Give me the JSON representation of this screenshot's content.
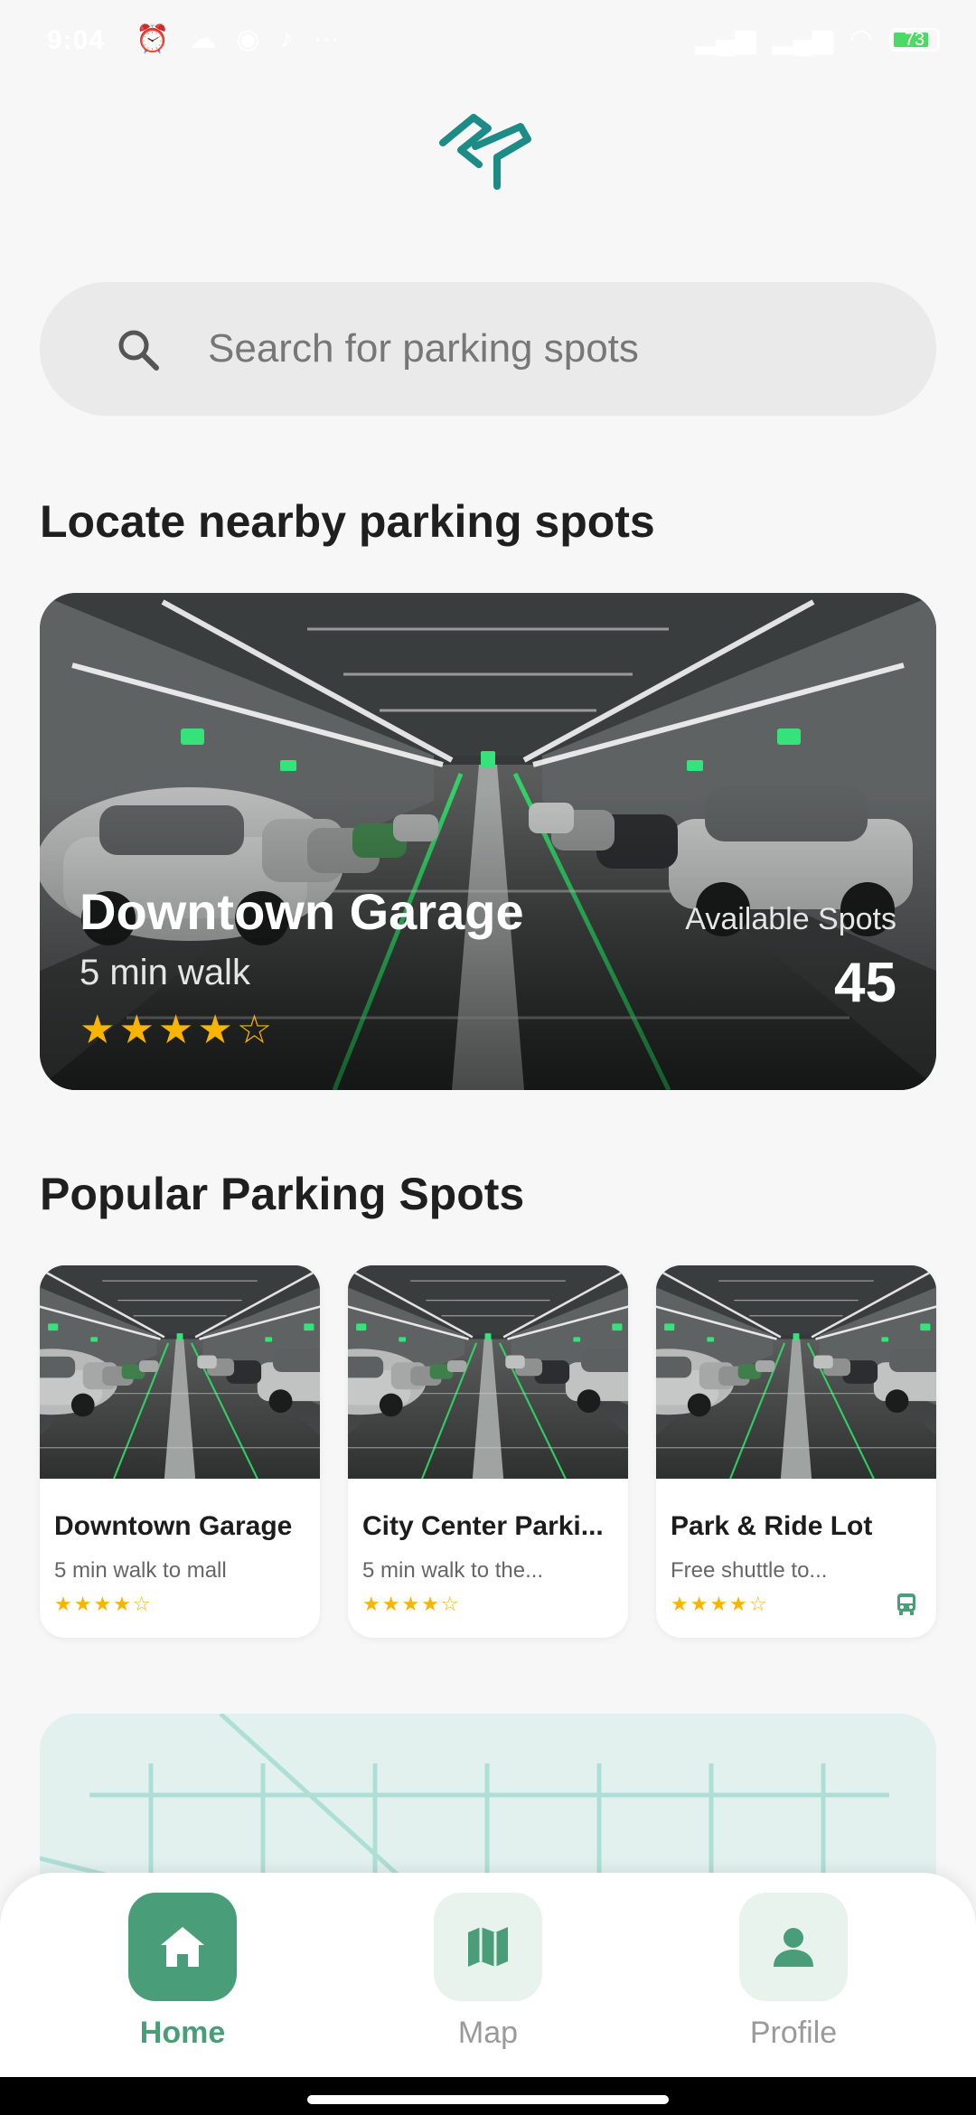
{
  "status_bar": {
    "time": "9:04",
    "battery": "73"
  },
  "search": {
    "placeholder": "Search for parking spots"
  },
  "nearby": {
    "title": "Locate nearby parking spots",
    "featured": {
      "name": "Downtown Garage",
      "walk": "5 min walk",
      "rating": 4,
      "rating_text": "★★★★☆",
      "available_label": "Available Spots",
      "available_count": "45"
    }
  },
  "popular": {
    "title": "Popular Parking Spots",
    "items": [
      {
        "name": "Downtown Garage",
        "desc": "5 min walk to mall",
        "rating_text": "★★★★☆"
      },
      {
        "name": "City Center Parki...",
        "desc": "5 min walk to the...",
        "rating_text": "★★★★☆"
      },
      {
        "name": "Park & Ride Lot",
        "desc": "Free shuttle to...",
        "rating_text": "★★★★☆",
        "icon": "bus-icon"
      }
    ]
  },
  "nav": {
    "items": [
      {
        "label": "Home",
        "icon": "home-icon",
        "active": true
      },
      {
        "label": "Map",
        "icon": "map-icon",
        "active": false
      },
      {
        "label": "Profile",
        "icon": "person-icon",
        "active": false
      }
    ]
  },
  "colors": {
    "accent": "#4a9d79",
    "accent_light": "#e8f3ee",
    "star": "#f7b400",
    "logo": "#1e8c86"
  }
}
